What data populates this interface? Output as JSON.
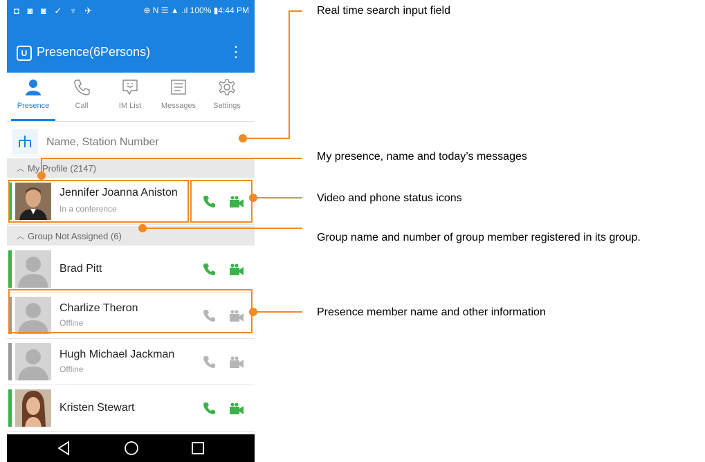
{
  "status_bar": {
    "left_icons": "◘ ◙ ◙ ✓ ♆ ✈",
    "right_text": "⊕ N ☰ ▲ .ıl 100% ▮4:44 PM"
  },
  "app_bar": {
    "logo": "U",
    "title": "Presence(6Persons)",
    "menu_icon": "⋮"
  },
  "tabs": [
    {
      "label": "Presence",
      "icon": "person-icon",
      "active": true
    },
    {
      "label": "Call",
      "icon": "phone-icon",
      "active": false
    },
    {
      "label": "IM List",
      "icon": "chat-icon",
      "active": false
    },
    {
      "label": "Messages",
      "icon": "list-icon",
      "active": false
    },
    {
      "label": "Settings",
      "icon": "gear-icon",
      "active": false
    }
  ],
  "search": {
    "placeholder": "Name, Station Number",
    "value": ""
  },
  "sections": [
    {
      "label": "My Profile (2147)"
    },
    {
      "label": "Group Not Assigned (6)"
    }
  ],
  "contacts": [
    {
      "name": "Jennifer Joanna Aniston",
      "status": "In a conference",
      "status_color": "#3cb24a",
      "phone_color": "#3cb24a",
      "video_color": "#3cb24a"
    },
    {
      "name": "Brad Pitt",
      "status": "",
      "status_color": "#3cb24a",
      "phone_color": "#3cb24a",
      "video_color": "#3cb24a"
    },
    {
      "name": "Charlize Theron",
      "status": "Offline",
      "status_color": "#9a9a9a",
      "phone_color": "#b5b5b5",
      "video_color": "#b5b5b5"
    },
    {
      "name": "Hugh Michael Jackman",
      "status": "Offline",
      "status_color": "#9a9a9a",
      "phone_color": "#b5b5b5",
      "video_color": "#b5b5b5"
    },
    {
      "name": "Kristen Stewart",
      "status": "",
      "status_color": "#3cb24a",
      "phone_color": "#3cb24a",
      "video_color": "#3cb24a"
    }
  ],
  "nav_bar": {
    "back": "back-icon",
    "home": "home-icon",
    "recents": "recents-icon"
  },
  "callouts": [
    "Real time search input field",
    "My presence, name and today’s messages",
    "Video and phone status icons",
    "Group name and number of group member registered in its group.",
    "Presence member name and other information"
  ],
  "colors": {
    "brand_blue": "#1c82e0",
    "callout_orange": "#f08a24",
    "online_green": "#3cb24a",
    "offline_gray": "#b5b5b5"
  }
}
